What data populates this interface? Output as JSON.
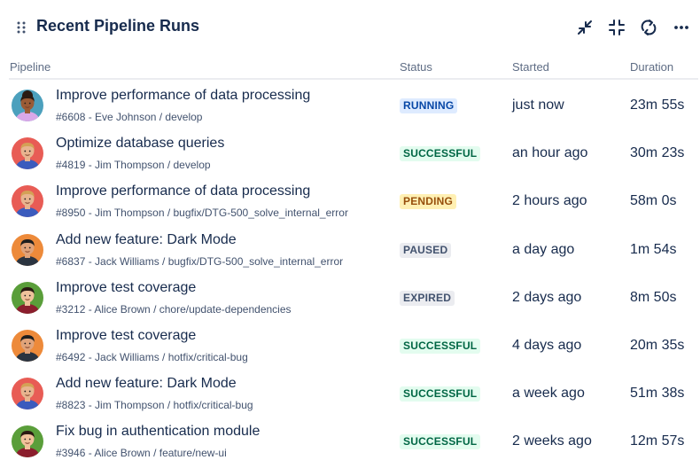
{
  "widget": {
    "title": "Recent Pipeline Runs",
    "toolbar": {
      "icons": [
        "collapse-arrows-icon",
        "minimize-icon",
        "refresh-icon",
        "more-icon"
      ]
    }
  },
  "table": {
    "columns": {
      "pipeline": "Pipeline",
      "status": "Status",
      "started": "Started",
      "duration": "Duration"
    },
    "rows": [
      {
        "title": "Improve performance of data processing",
        "meta": "#6608 - Eve Johnson / develop",
        "status": "RUNNING",
        "started": "just now",
        "duration": "23m 55s",
        "avatar": {
          "bg": "#4ca0bd",
          "skin": "#9a5b35",
          "hair": "#2a1a12",
          "shirt": "#d9a8e8",
          "bun": true
        }
      },
      {
        "title": "Optimize database queries",
        "meta": "#4819 - Jim Thompson / develop",
        "status": "SUCCESSFUL",
        "started": "an hour ago",
        "duration": "30m 23s",
        "avatar": {
          "bg": "#e85c55",
          "skin": "#e8b48f",
          "hair": "#d4a156",
          "shirt": "#3b5bbd",
          "bun": false
        }
      },
      {
        "title": "Improve performance of data processing",
        "meta": "#8950 - Jim Thompson / bugfix/DTG-500_solve_internal_error",
        "status": "PENDING",
        "started": "2 hours ago",
        "duration": "58m 0s",
        "avatar": {
          "bg": "#e85c55",
          "skin": "#e8b48f",
          "hair": "#d4a156",
          "shirt": "#3b5bbd",
          "bun": false
        }
      },
      {
        "title": "Add new feature: Dark Mode",
        "meta": "#6837 - Jack Williams / bugfix/DTG-500_solve_internal_error",
        "status": "PAUSED",
        "started": "a day ago",
        "duration": "1m 54s",
        "avatar": {
          "bg": "#ed8a3a",
          "skin": "#e0a37a",
          "hair": "#1e1e1e",
          "shirt": "#2b3440",
          "bun": false
        }
      },
      {
        "title": "Improve test coverage",
        "meta": "#3212 - Alice Brown / chore/update-dependencies",
        "status": "EXPIRED",
        "started": "2 days ago",
        "duration": "8m 50s",
        "avatar": {
          "bg": "#5a9e3a",
          "skin": "#f0c29b",
          "hair": "#2a1a12",
          "shirt": "#8b1e2d",
          "bun": false
        }
      },
      {
        "title": "Improve test coverage",
        "meta": "#6492 - Jack Williams / hotfix/critical-bug",
        "status": "SUCCESSFUL",
        "started": "4 days ago",
        "duration": "20m 35s",
        "avatar": {
          "bg": "#ed8a3a",
          "skin": "#e0a37a",
          "hair": "#1e1e1e",
          "shirt": "#2b3440",
          "bun": false
        }
      },
      {
        "title": "Add new feature: Dark Mode",
        "meta": "#8823 - Jim Thompson / hotfix/critical-bug",
        "status": "SUCCESSFUL",
        "started": "a week ago",
        "duration": "51m 38s",
        "avatar": {
          "bg": "#e85c55",
          "skin": "#e8b48f",
          "hair": "#d4a156",
          "shirt": "#3b5bbd",
          "bun": false
        }
      },
      {
        "title": "Fix bug in authentication module",
        "meta": "#3946 - Alice Brown / feature/new-ui",
        "status": "SUCCESSFUL",
        "started": "2 weeks ago",
        "duration": "12m 57s",
        "avatar": {
          "bg": "#5a9e3a",
          "skin": "#f0c29b",
          "hair": "#2a1a12",
          "shirt": "#8b1e2d",
          "bun": false
        }
      }
    ]
  },
  "status_colors": {
    "RUNNING": {
      "bg": "#deebff",
      "fg": "#0747a6"
    },
    "SUCCESSFUL": {
      "bg": "#e3fcef",
      "fg": "#006644"
    },
    "PENDING": {
      "bg": "#fff0b3",
      "fg": "#974f0c"
    },
    "PAUSED": {
      "bg": "#ebecf0",
      "fg": "#42526e"
    },
    "EXPIRED": {
      "bg": "#ebecf0",
      "fg": "#42526e"
    }
  }
}
